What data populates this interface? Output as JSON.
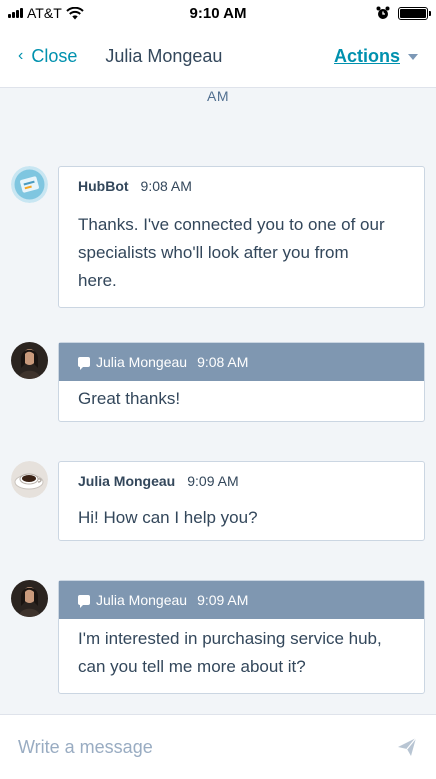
{
  "status_bar": {
    "carrier": "AT&T",
    "time": "9:10 AM",
    "icons": [
      "signal-icon",
      "wifi-icon",
      "alarm-icon",
      "battery-icon"
    ]
  },
  "header": {
    "close_label": "Close",
    "contact_name": "Julia Mongeau",
    "actions_label": "Actions"
  },
  "date_stub": "AM",
  "messages": [
    {
      "author": "HubBot",
      "time": "9:08 AM",
      "lines": [
        "Thanks. I've connected you to one of our",
        "specialists who'll look after you from",
        "here."
      ],
      "variant": "bot"
    },
    {
      "author": "Julia Mongeau",
      "time": "9:08 AM",
      "lines": [
        "Great thanks!"
      ],
      "variant": "agent"
    },
    {
      "author": "Julia Mongeau",
      "time": "9:09 AM",
      "lines": [
        "Hi! How can I help you?"
      ],
      "variant": "visitor"
    },
    {
      "author": "Julia Mongeau",
      "time": "9:09 AM",
      "lines": [
        "I'm interested in purchasing service hub,",
        "can you tell me more about it?"
      ],
      "variant": "agent"
    }
  ],
  "composer": {
    "placeholder": "Write a message"
  },
  "colors": {
    "accent": "#0091ae",
    "agent_header": "#7f97b1",
    "background": "#f2f5f8",
    "text": "#33475b"
  }
}
